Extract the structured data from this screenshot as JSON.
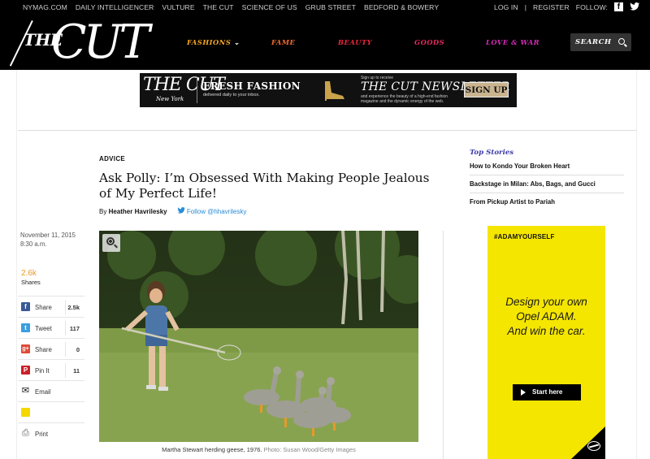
{
  "topbar": {
    "links": [
      "NYMAG.COM",
      "DAILY INTELLIGENCER",
      "VULTURE",
      "THE CUT",
      "SCIENCE OF US",
      "GRUB STREET",
      "BEDFORD & BOWERY"
    ],
    "login": "LOG IN",
    "sep": "|",
    "register": "REGISTER",
    "follow": "FOLLOW:"
  },
  "header": {
    "logo_the": "THE",
    "logo_cut": "CUT",
    "nav": [
      {
        "label": "FASHIONS",
        "color": "#f5a623",
        "chevron": "⌄"
      },
      {
        "label": "FAME",
        "color": "#f26b2b"
      },
      {
        "label": "BEAUTY",
        "color": "#e8283c"
      },
      {
        "label": "GOODS",
        "color": "#e8295f"
      },
      {
        "label": "LOVE & WAR",
        "color": "#d629b8"
      }
    ],
    "search_label": "SEARCH"
  },
  "banner": {
    "logo": "THE CUT",
    "logo_sub": "New York",
    "fresh": "FRESH FASHION",
    "fresh_sub": "delivered daily to your inbox.",
    "signup_pre": "Sign up to receive",
    "newsletter": "THE CUT NEWSLETTER",
    "newsletter_sub": "and experience the beauty of a high-end fashion magazine and the dynamic energy of the web.",
    "signup": "SIGN UP"
  },
  "article": {
    "section": "ADVICE",
    "title": "Ask Polly: I’m Obsessed With Making People Jealous of My Perfect Life!",
    "by": "By",
    "author": "Heather Havrilesky",
    "follow": "Follow @hhavrilesky",
    "date": "November 11, 2015",
    "time": "8:30 a.m.",
    "caption": "Martha Stewart herding geese, 1976.",
    "credit": "Photo: Susan Wood/Getty Images"
  },
  "shares": {
    "count": "2.6k",
    "label": "Shares",
    "items": [
      {
        "name": "facebook",
        "icon": "f",
        "color": "#3b5998",
        "label": "Share",
        "count": "2.5k"
      },
      {
        "name": "twitter",
        "icon": "t",
        "color": "#3a9ee0",
        "label": "Tweet",
        "count": "117"
      },
      {
        "name": "googleplus",
        "icon": "g+",
        "color": "#dd4b39",
        "label": "Share",
        "count": "0"
      },
      {
        "name": "pinterest",
        "icon": "P",
        "color": "#cb2027",
        "label": "Pin It",
        "count": "11"
      },
      {
        "name": "email",
        "icon": "✉",
        "color": "#222",
        "label": "Email",
        "count": ""
      },
      {
        "name": "comment",
        "icon": "",
        "color": "#f5d800",
        "label": "",
        "count": ""
      },
      {
        "name": "print",
        "icon": "⎙",
        "color": "#bbb",
        "label": "Print",
        "count": ""
      }
    ]
  },
  "top_stories": {
    "heading": "Top Stories",
    "items": [
      "How to Kondo Your Broken Heart",
      "Backstage in Milan: Abs, Bags, and Gucci",
      "From Pickup Artist to Pariah"
    ]
  },
  "ad": {
    "hashtag": "#ADAMYOURSELF",
    "line1": "Design your own",
    "line2": "Opel ADAM.",
    "line3": "And win the car.",
    "cta": "Start here"
  }
}
